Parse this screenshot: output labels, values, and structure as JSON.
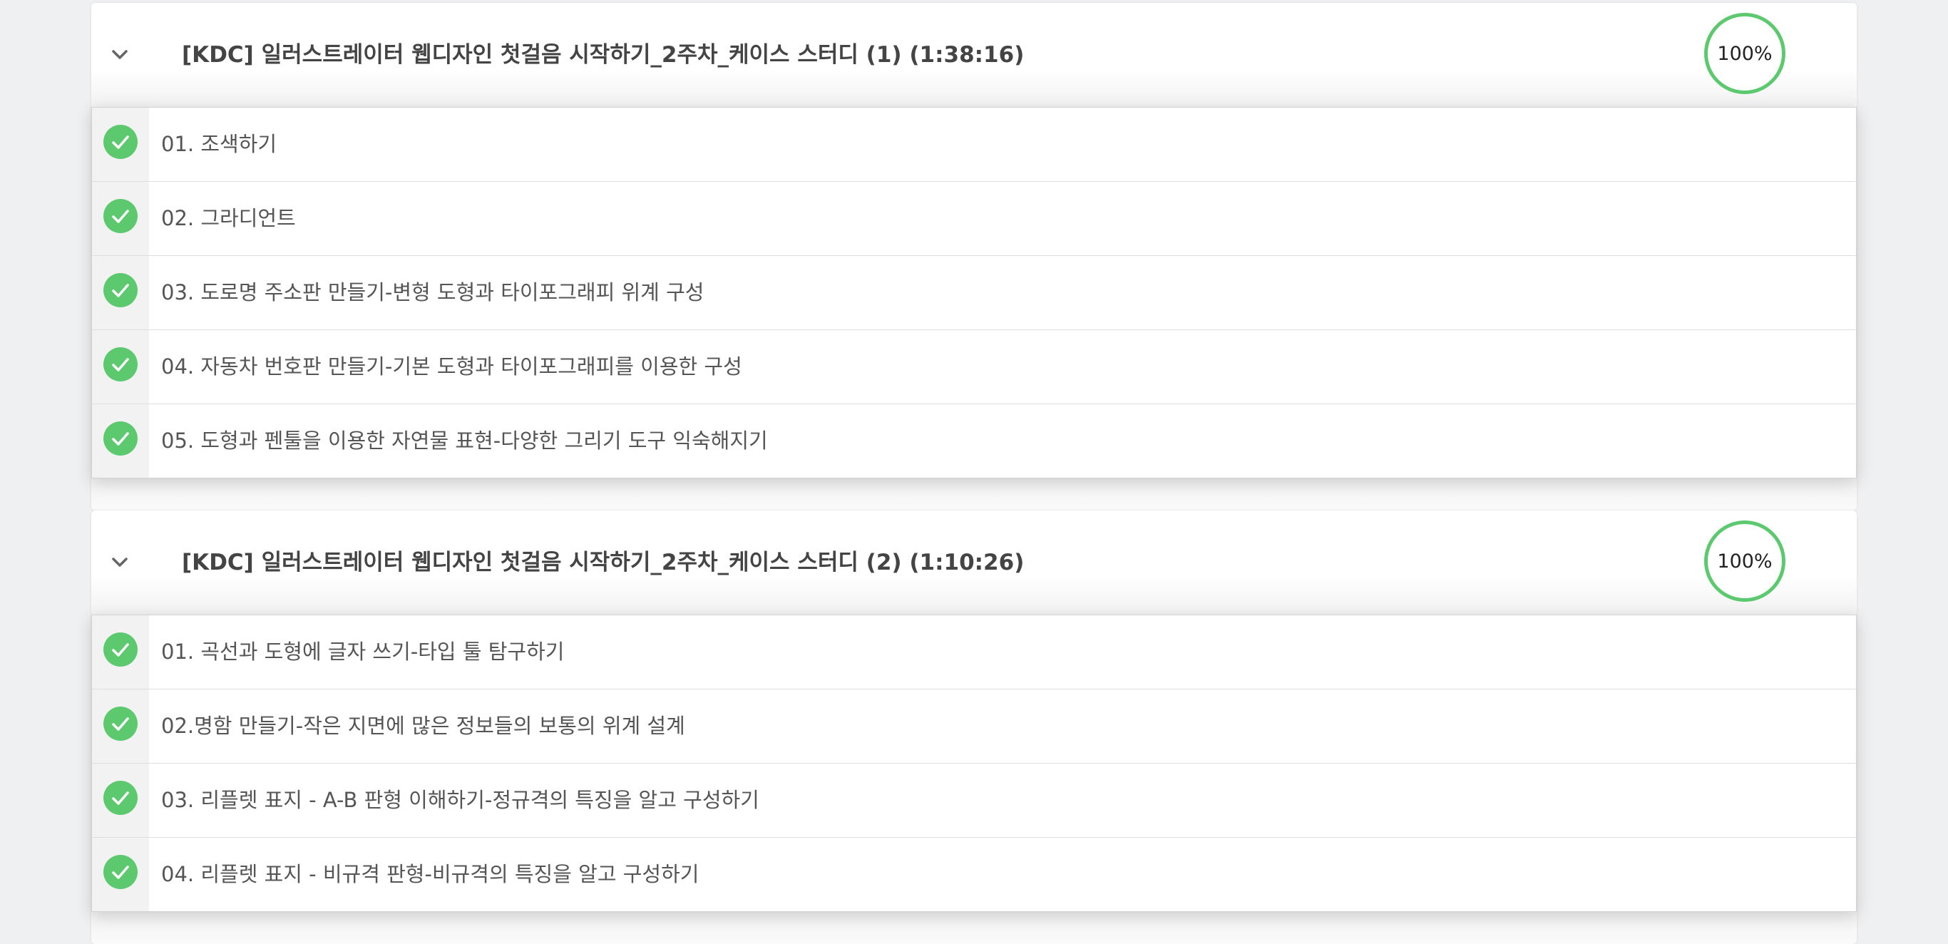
{
  "sections": [
    {
      "title": "[KDC] 일러스트레이터 웹디자인 첫걸음 시작하기_2주차_케이스 스터디 (1) (1:38:16)",
      "progress": "100%",
      "progress_value": 1.0,
      "expanded": true,
      "lessons": [
        {
          "label": "01. 조색하기",
          "completed": true
        },
        {
          "label": "02. 그라디언트",
          "completed": true
        },
        {
          "label": "03. 도로명 주소판 만들기-변형 도형과 타이포그래피 위계 구성",
          "completed": true
        },
        {
          "label": "04. 자동차 번호판 만들기-기본 도형과 타이포그래피를 이용한 구성",
          "completed": true
        },
        {
          "label": "05. 도형과 펜툴을 이용한 자연물 표현-다양한 그리기 도구 익숙해지기",
          "completed": true
        }
      ]
    },
    {
      "title": "[KDC] 일러스트레이터 웹디자인 첫걸음 시작하기_2주차_케이스 스터디 (2) (1:10:26)",
      "progress": "100%",
      "progress_value": 1.0,
      "expanded": true,
      "lessons": [
        {
          "label": "01. 곡선과 도형에 글자 쓰기-타입 툴 탐구하기",
          "completed": true
        },
        {
          "label": "02.명함 만들기-작은 지면에 많은 정보들의 보통의 위계 설계",
          "completed": true
        },
        {
          "label": "03. 리플렛 표지 - A-B 판형 이해하기-정규격의 특징을 알고 구성하기",
          "completed": true
        },
        {
          "label": "04. 리플렛 표지 - 비규격 판형-비규격의 특징을 알고 구성하기",
          "completed": true
        }
      ]
    }
  ],
  "colors": {
    "page_background": "#eff0f2",
    "progress_green": "#5cc96f",
    "title_text": "#444444",
    "lesson_text": "#555555"
  },
  "icons": {
    "expand": "chevron-down-icon",
    "completed": "check-circle-icon"
  }
}
